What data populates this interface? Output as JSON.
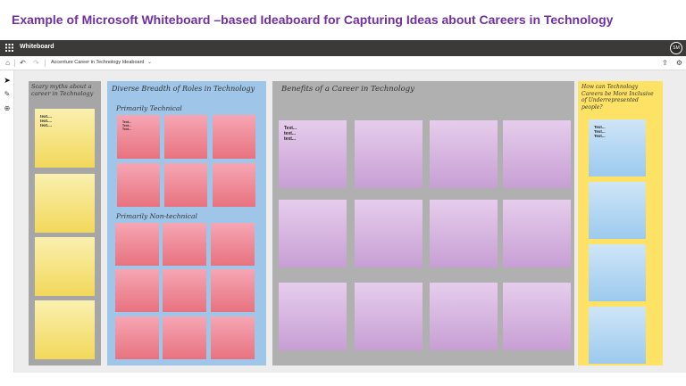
{
  "slide": {
    "title": "Example of Microsoft Whiteboard –based Ideaboard for Capturing Ideas about Careers in Technology"
  },
  "app": {
    "name": "Whiteboard",
    "avatar_initials": "SM",
    "board_name": "Accenture Career in Technology Ideaboard"
  },
  "icons": {
    "grid": "app-launcher-icon",
    "home": "home-icon",
    "undo": "undo-icon",
    "redo": "redo-icon",
    "chevron": "chevron-down-icon",
    "share": "share-icon",
    "settings": "gear-icon",
    "select": "select-pointer-icon",
    "pen": "pen-icon",
    "add": "add-icon"
  },
  "frames": {
    "myths": {
      "title": "Scary myths about a career in Technology",
      "color": "#a6a6a6",
      "note_text": "text....\ntext....\ntext...."
    },
    "roles": {
      "title": "Diverse Breadth of Roles in Technology",
      "color": "#9fc6e8",
      "technical_heading": "Primarily Technical",
      "nontechnical_heading": "Primarily Non-technical",
      "note_text": "Text...\nText...\nText..."
    },
    "benefits": {
      "title": "Benefits of a Career in Technology",
      "color": "#b0b0b0",
      "note_text": "Text...\ntext...\ntext..."
    },
    "inclusive": {
      "title": "How can Technology Careers be More Inclusive of Underrepresented people?",
      "color": "#fde265",
      "note_text": "Text...\nText...\nText..."
    }
  }
}
